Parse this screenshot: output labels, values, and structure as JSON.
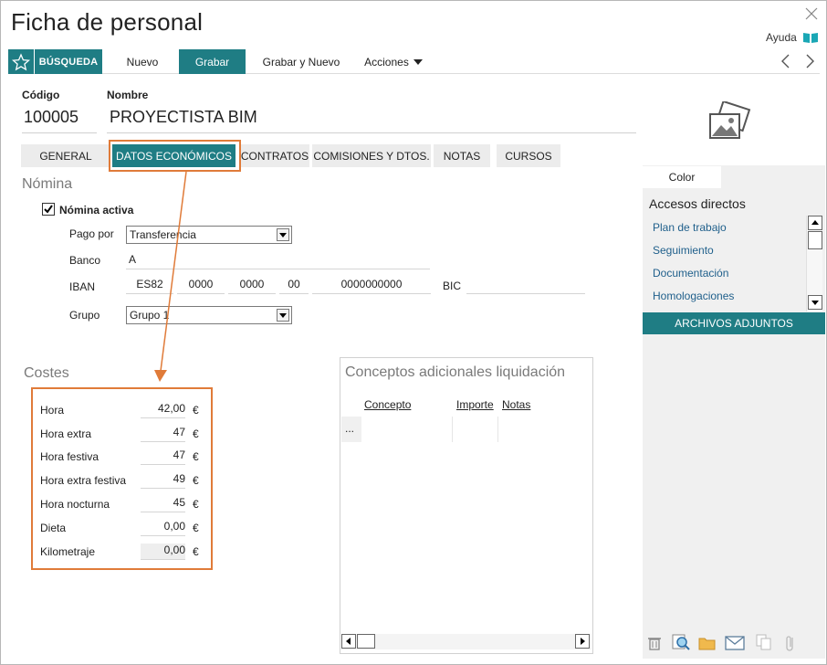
{
  "window": {
    "title": "Ficha de personal"
  },
  "help": {
    "label": "Ayuda"
  },
  "toolbar": {
    "search_label": "BÚSQUEDA",
    "new_label": "Nuevo",
    "save_label": "Grabar",
    "save_new_label": "Grabar y Nuevo",
    "actions_label": "Acciones"
  },
  "header": {
    "code_label": "Código",
    "code_value": "100005",
    "name_label": "Nombre",
    "name_value": "PROYECTISTA BIM"
  },
  "tabs": [
    {
      "label": "GENERAL"
    },
    {
      "label": "DATOS ECONÓMICOS"
    },
    {
      "label": "CONTRATOS"
    },
    {
      "label": "COMISIONES Y DTOS."
    },
    {
      "label": "NOTAS"
    },
    {
      "label": "CURSOS"
    }
  ],
  "active_tab": "DATOS ECONÓMICOS",
  "nomina": {
    "title": "Nómina",
    "active_label": "Nómina activa",
    "active_checked": true,
    "pago_label": "Pago por",
    "pago_value": "Transferencia",
    "banco_label": "Banco",
    "banco_value": "A",
    "iban_label": "IBAN",
    "iban": [
      "ES82",
      "0000",
      "0000",
      "00",
      "0000000000"
    ],
    "bic_label": "BIC",
    "bic_value": "",
    "grupo_label": "Grupo",
    "grupo_value": "Grupo 1"
  },
  "costes": {
    "title": "Costes",
    "currency": "€",
    "rows": [
      {
        "label": "Hora",
        "value": "42,00"
      },
      {
        "label": "Hora extra",
        "value": "47"
      },
      {
        "label": "Hora festiva",
        "value": "47"
      },
      {
        "label": "Hora extra festiva",
        "value": "49"
      },
      {
        "label": "Hora nocturna",
        "value": "45"
      },
      {
        "label": "Dieta",
        "value": "0,00"
      },
      {
        "label": "Kilometraje",
        "value": "0,00"
      }
    ]
  },
  "conceptos": {
    "title": "Conceptos adicionales liquidación",
    "col_concepto": "Concepto",
    "col_importe": "Importe",
    "col_notas": "Notas",
    "row_ellipsis": "..."
  },
  "right_panel": {
    "color_label": "Color",
    "accesos_title": "Accesos directos",
    "links": [
      {
        "label": "Plan de trabajo"
      },
      {
        "label": "Seguimiento"
      },
      {
        "label": "Documentación"
      },
      {
        "label": "Homologaciones"
      }
    ],
    "attachments_label": "ARCHIVOS ADJUNTOS"
  },
  "colors": {
    "accent": "#1f7d84",
    "highlight": "#e07b39",
    "link": "#1f5f8b"
  },
  "icons": [
    "close-icon",
    "help-book-icon",
    "star-icon",
    "caret-down-icon",
    "chevron-left-icon",
    "chevron-right-icon",
    "photo-placeholder-icon",
    "trash-icon",
    "search-doc-icon",
    "folder-icon",
    "mail-icon",
    "copy-icon",
    "paperclip-icon"
  ]
}
